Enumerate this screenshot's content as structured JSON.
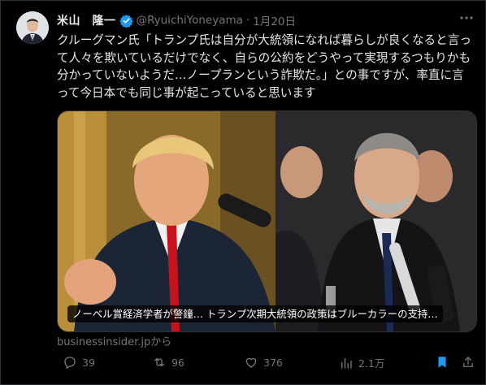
{
  "author": {
    "display_name": "米山　隆一",
    "handle": "@RyuichiYoneyama",
    "separator": "·",
    "date": "1月20日",
    "verified_color": "#1d9bf0"
  },
  "more_icon": "more-dots-icon",
  "tweet": {
    "text": "クルーグマン氏「トランプ氏は自分が大統領になれば暮らしが良くなると言って人々を欺いているだけでなく、自らの公約をどうやって実現するつもりかも分かっていないようだ…ノープランという詐欺だ。」との事ですが、率直に言って今日本でも同じ事が起こっていると思います"
  },
  "card": {
    "caption": "ノーベル賞経済学者が警鐘… トランプ次期大統領の政策はブルーカラーの支持…",
    "source": "businessinsider.jpから"
  },
  "actions": {
    "reply_count": "39",
    "retweet_count": "96",
    "like_count": "376",
    "view_count": "2.1万"
  },
  "colors": {
    "background": "#000000",
    "text": "#e7e9ea",
    "muted": "#71767b",
    "accent": "#1d9bf0"
  }
}
